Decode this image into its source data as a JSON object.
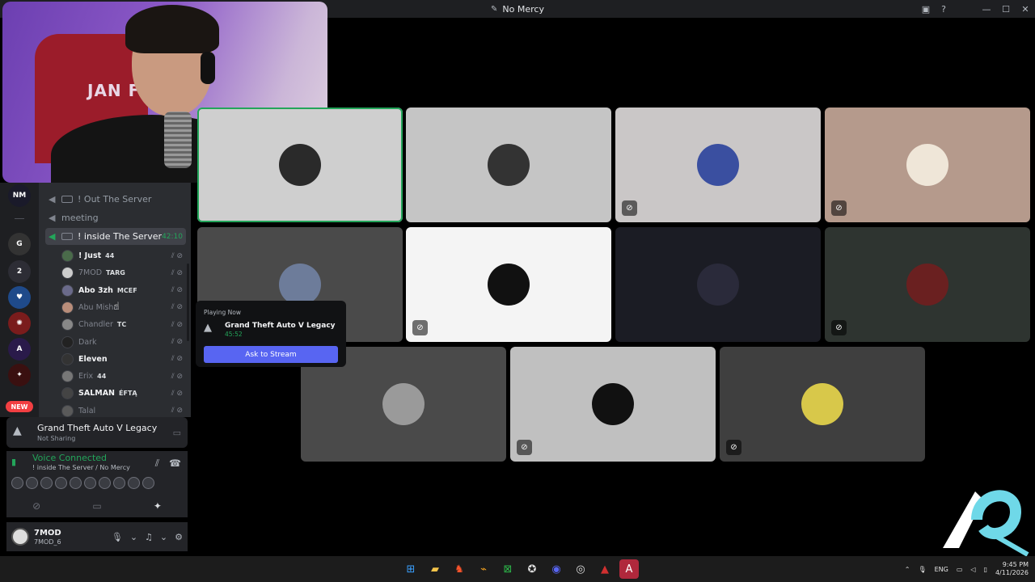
{
  "window": {
    "title": "No Mercy"
  },
  "channels": [
    {
      "name": "! Out The Server"
    },
    {
      "name": "meeting"
    },
    {
      "name": "! inside The Server",
      "timer": "42:10"
    }
  ],
  "members": [
    {
      "name": "! Just",
      "tag": "44",
      "dim": false,
      "avatar_color": "#4a6b4a"
    },
    {
      "name": "7MOD",
      "tag": "TARG",
      "dim": true,
      "avatar_color": "#cccccc"
    },
    {
      "name": "Abo 3zh",
      "tag": "MCEF",
      "dim": false,
      "avatar_color": "#6a6a8a"
    },
    {
      "name": "Abu Misha",
      "tag": "",
      "dim": true,
      "avatar_color": "#b98d7a"
    },
    {
      "name": "Chandler",
      "tag": "TC",
      "dim": true,
      "avatar_color": "#888888"
    },
    {
      "name": "Dark",
      "tag": "",
      "dim": true,
      "avatar_color": "#222222"
    },
    {
      "name": "Eleven",
      "tag": "",
      "dim": false,
      "avatar_color": "#333333"
    },
    {
      "name": "Erix",
      "tag": "44",
      "dim": true,
      "avatar_color": "#777777"
    },
    {
      "name": "SALMAN",
      "tag": "ÉFTĄ",
      "dim": false,
      "avatar_color": "#444444"
    },
    {
      "name": "Talal",
      "tag": "",
      "dim": true,
      "avatar_color": "#5a5a5a"
    }
  ],
  "activity": {
    "game": "Grand Theft Auto V Legacy",
    "status": "Not Sharing"
  },
  "voice": {
    "status": "Voice Connected",
    "location": "! inside The Server / No Mercy"
  },
  "user": {
    "display": "7MOD",
    "status": "7MOD_6"
  },
  "rail": {
    "new_label": "NEW"
  },
  "popout": {
    "heading": "Playing Now",
    "game": "Grand Theft Auto V Legacy",
    "elapsed": "45:52",
    "button": "Ask to Stream"
  },
  "cam": {
    "chair_text": "JAN F.C."
  },
  "tiles": [
    {
      "bg": "#cfcfcf",
      "avatar": "#2a2a2a",
      "badge": false,
      "speaking": true
    },
    {
      "bg": "#c5c5c5",
      "avatar": "#333333",
      "badge": false,
      "speaking": false
    },
    {
      "bg": "#cac7c7",
      "avatar": "#3a4fa0",
      "badge": true,
      "speaking": false
    },
    {
      "bg": "#b59a8c",
      "avatar": "#efe6d8",
      "badge": true,
      "speaking": false
    },
    {
      "bg": "#4a4a4a",
      "avatar": "#6d7c9a",
      "badge": false,
      "speaking": false
    },
    {
      "bg": "#f4f4f4",
      "avatar": "#111111",
      "badge": true,
      "speaking": false
    },
    {
      "bg": "#1b1c24",
      "avatar": "#2a2a3a",
      "badge": false,
      "speaking": false
    },
    {
      "bg": "#2e3430",
      "avatar": "#6a2020",
      "badge": true,
      "speaking": false
    },
    {
      "bg": "#4a4a4a",
      "avatar": "#9a9a9a",
      "badge": false,
      "speaking": false
    },
    {
      "bg": "#c0c0c0",
      "avatar": "#111111",
      "badge": true,
      "speaking": false
    },
    {
      "bg": "#3f3f3f",
      "avatar": "#d8c84a",
      "badge": true,
      "speaking": false
    }
  ],
  "tray": {
    "lang": "ENG",
    "time": "9:45 PM",
    "date": "4/11/2026"
  },
  "colors": {
    "accent": "#5865f2",
    "online": "#23a55a",
    "danger": "#f23f42"
  }
}
